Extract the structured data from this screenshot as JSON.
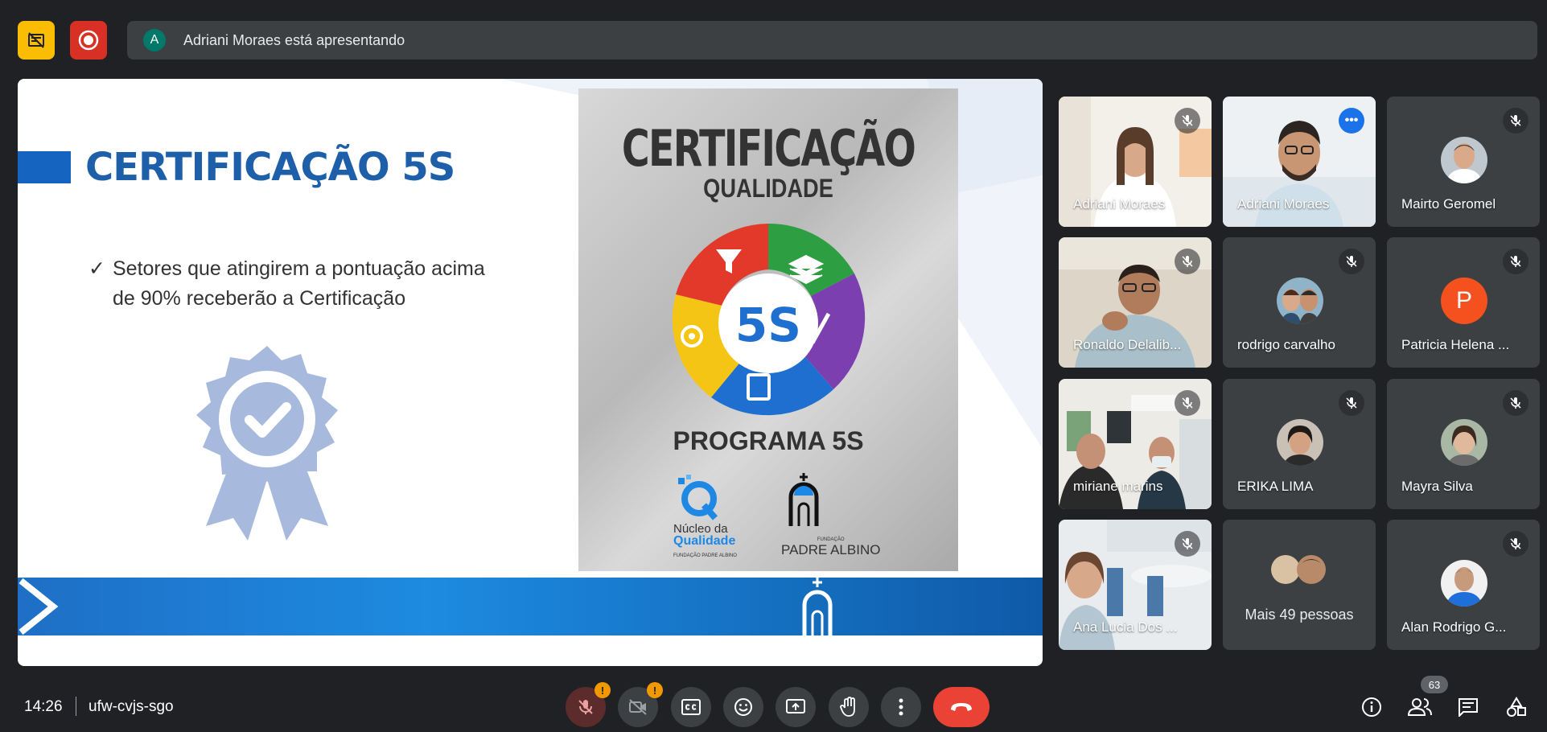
{
  "presenter": {
    "avatar_letter": "A",
    "text": "Adriani Moraes está apresentando"
  },
  "slide": {
    "title": "CERTIFICAÇÃO 5S",
    "bullet_check": "✓",
    "bullet_text": "Setores que atingirem a pontuação acima de 90% receberão a Certificação",
    "poster_title": "CERTIFICAÇÃO",
    "poster_subtitle": "QUALIDADE",
    "poster_center": "5S",
    "poster_program": "PROGRAMA 5S",
    "logo1_line1": "Núcleo da",
    "logo1_line2": "Qualidade",
    "logo1_line3": "FUNDAÇÃO PADRE ALBINO",
    "logo2_small": "FUNDAÇÃO",
    "logo2_text": "PADRE ALBINO"
  },
  "participants": [
    {
      "name": "Adriani Moraes",
      "muted": true,
      "kind": "video"
    },
    {
      "name": "Adriani Moraes",
      "muted": false,
      "kind": "video",
      "active": true,
      "more": "•••"
    },
    {
      "name": "Mairto Geromel",
      "muted": true,
      "kind": "photo"
    },
    {
      "name": "Ronaldo Delalib...",
      "muted": true,
      "kind": "video"
    },
    {
      "name": "rodrigo carvalho",
      "muted": true,
      "kind": "photo"
    },
    {
      "name": "Patricia Helena ...",
      "muted": true,
      "kind": "letter",
      "letter": "P"
    },
    {
      "name": "miriane marins",
      "muted": true,
      "kind": "video"
    },
    {
      "name": "ERIKA LIMA",
      "muted": true,
      "kind": "photo"
    },
    {
      "name": "Mayra Silva",
      "muted": true,
      "kind": "photo"
    },
    {
      "name": "Ana Lucia Dos ...",
      "muted": true,
      "kind": "video"
    },
    {
      "name": "Mais 49 pessoas",
      "muted": false,
      "kind": "more"
    },
    {
      "name": "Alan Rodrigo G...",
      "muted": true,
      "kind": "photo"
    }
  ],
  "footer": {
    "time": "14:26",
    "meeting_code": "ufw-cvjs-sgo",
    "participant_count": "63"
  },
  "colors": {
    "bg": "#202124",
    "tile": "#3c4043",
    "accent": "#1a73e8",
    "danger": "#ea4335",
    "warning": "#f29900",
    "record": "#d93025",
    "present": "#fbbc04"
  },
  "icons": [
    "no-presentation-icon",
    "record-icon",
    "mic-off-icon",
    "camera-off-icon",
    "captions-icon",
    "emoji-icon",
    "present-icon",
    "raise-hand-icon",
    "more-vert-icon",
    "hang-up-icon",
    "info-icon",
    "people-icon",
    "chat-icon",
    "activities-icon"
  ]
}
